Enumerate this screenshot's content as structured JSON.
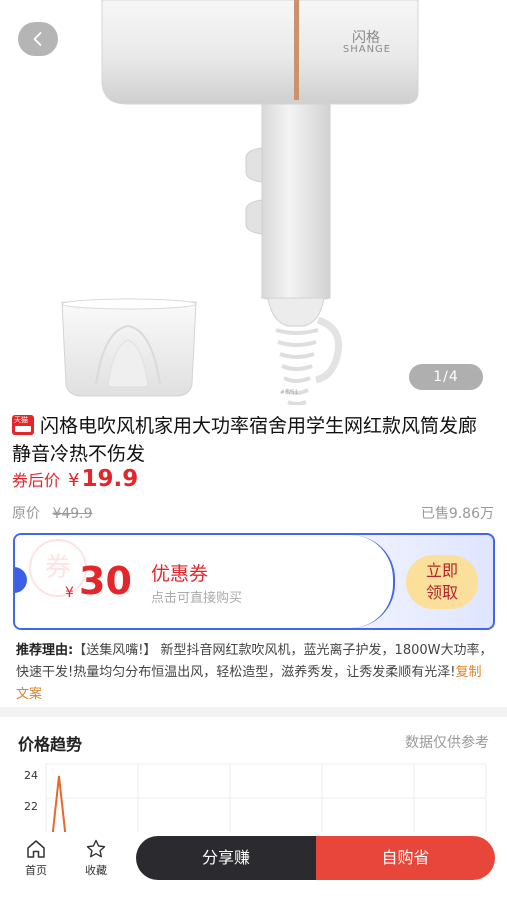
{
  "gallery": {
    "brand_cn": "闪格",
    "brand_en": "SHANGE",
    "pager": "1/4"
  },
  "product": {
    "platform_badge": "天猫",
    "title": "闪格电吹风机家用大功率宿舍用学生网红款风筒发廊静音冷热不伤发",
    "price_label": "券后价",
    "currency": "¥",
    "price": "19.9",
    "original_label": "原价",
    "original_price": "¥49.9",
    "sold": "已售9.86万"
  },
  "coupon": {
    "stamp": "券",
    "currency": "¥",
    "amount": "30",
    "title": "优惠券",
    "subtitle": "点击可直接购买",
    "claim_line1": "立即",
    "claim_line2": "领取",
    "border_color": "#4466e8"
  },
  "recommend": {
    "label": "推荐理由:",
    "text": "【送集风嘴!】 新型抖音网红款吹风机，蓝光离子护发，1800W大功率，快速干发!热量均匀分布恒温出风，轻松造型，滋养秀发，让秀发柔顺有光泽!",
    "copy_link": "复制文案"
  },
  "trend": {
    "title": "价格趋势",
    "note": "数据仅供参考"
  },
  "chart_data": {
    "type": "line",
    "title": "价格趋势",
    "y_ticks": [
      "24",
      "22"
    ],
    "ylim": [
      20,
      25
    ],
    "series_color": "#e8672d",
    "grid": true
  },
  "bottombar": {
    "home": "首页",
    "favorite": "收藏",
    "share": "分享赚",
    "buy": "自购省"
  },
  "colors": {
    "accent_red": "#e4262b",
    "buy_button": "#e8453b",
    "share_button": "#2b2b2f",
    "claim_button": "#fbe09b"
  }
}
